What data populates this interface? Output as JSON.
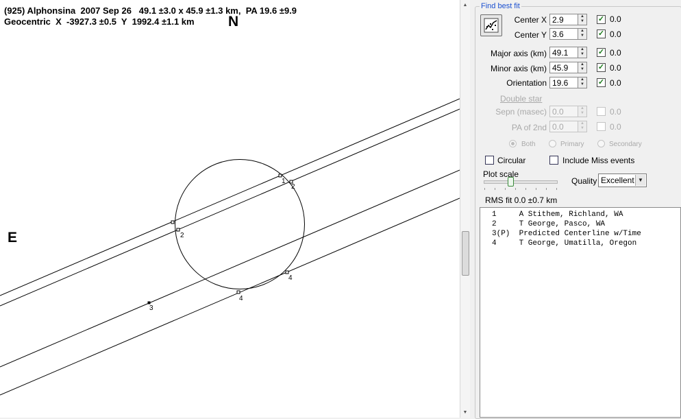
{
  "plot": {
    "header_line1": "(925) Alphonsina  2007 Sep 26   49.1 ±3.0 x 45.9 ±1.3 km,  PA 19.6 ±9.9",
    "header_line2": "Geocentric  X  -3927.3 ±0.5  Y  1992.4 ±1.1 km",
    "north_label": "N",
    "east_label": "E",
    "chord_labels": [
      "1",
      "2",
      "2",
      "3",
      "4",
      "4"
    ]
  },
  "panel": {
    "group_title": "Find best fit",
    "fit_button_icon": "chart-fit-icon",
    "center_x_label": "Center X",
    "center_x_value": "2.9",
    "center_x_check": "0.0",
    "center_y_label": "Center Y",
    "center_y_value": "3.6",
    "center_y_check": "0.0",
    "major_label": "Major axis (km)",
    "major_value": "49.1",
    "major_check": "0.0",
    "minor_label": "Minor axis (km)",
    "minor_value": "45.9",
    "minor_check": "0.0",
    "orient_label": "Orientation",
    "orient_value": "19.6",
    "orient_check": "0.0",
    "double_star_label": "Double star",
    "sepn_label": "Sepn (masec)",
    "sepn_value": "0.0",
    "sepn_check": "0.0",
    "pa2_label": "PA of 2nd",
    "pa2_value": "0.0",
    "pa2_check": "0.0",
    "radio_both": "Both",
    "radio_primary": "Primary",
    "radio_secondary": "Secondary",
    "circular_label": "Circular",
    "include_miss_label": "Include Miss events",
    "plot_scale_label": "Plot scale",
    "quality_label": "Quality",
    "quality_value": "Excellent",
    "rms_text": "RMS fit 0.0 ±0.7 km"
  },
  "observers": [
    "1     A Stithem, Richland, WA",
    "2     T George, Pasco, WA",
    "3(P)  Predicted Centerline w/Time",
    "4     T George, Umatilla, Oregon"
  ]
}
